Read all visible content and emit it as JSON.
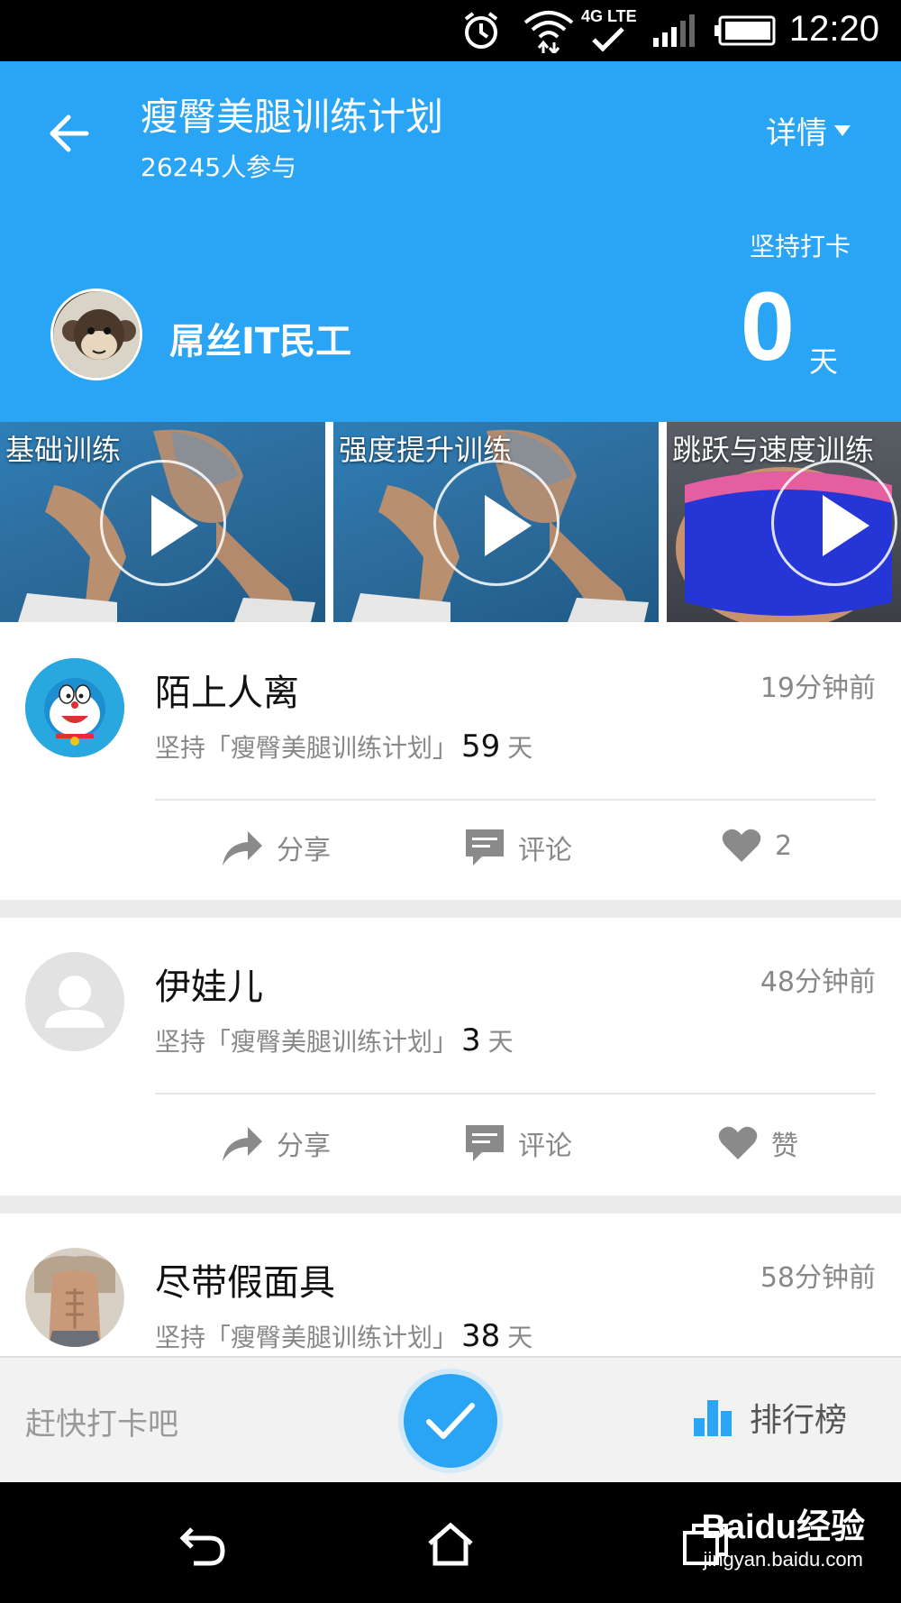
{
  "status_bar": {
    "time": "12:20",
    "network": "4G LTE",
    "icons": [
      "alarm-icon",
      "wifi-icon",
      "lte-icon",
      "signal-icon",
      "battery-icon"
    ]
  },
  "header": {
    "title": "瘦臀美腿训练计划",
    "participants": "26245人参与",
    "details_label": "详情",
    "streak_label": "坚持打卡",
    "streak_value": "0",
    "streak_unit": "天",
    "user_name": "屌丝IT民工",
    "bg_color": "#2aa4f4"
  },
  "videos": [
    {
      "label": "基础训练"
    },
    {
      "label": "强度提升训练"
    },
    {
      "label": "跳跃与速度训练"
    }
  ],
  "feed": [
    {
      "name": "陌上人离",
      "time": "19分钟前",
      "desc_prefix": "坚持「瘦臀美腿训练计划」",
      "days": "59",
      "days_unit": "天",
      "share_label": "分享",
      "comment_label": "评论",
      "like_label": "2",
      "avatar": "doraemon-avatar"
    },
    {
      "name": "伊娃儿",
      "time": "48分钟前",
      "desc_prefix": "坚持「瘦臀美腿训练计划」",
      "days": "3",
      "days_unit": "天",
      "share_label": "分享",
      "comment_label": "评论",
      "like_label": "赞",
      "avatar": "default-avatar"
    },
    {
      "name": "尽带假面具",
      "time": "58分钟前",
      "desc_prefix": "坚持「瘦臀美腿训练计划」",
      "days": "38",
      "days_unit": "天",
      "avatar": "photo-avatar"
    }
  ],
  "bottom_bar": {
    "hint": "赶快打卡吧",
    "rank_label": "排行榜",
    "accent": "#2aa4f4"
  },
  "watermark": {
    "main": "Baidu经验",
    "sub": "jingyan.baidu.com"
  }
}
